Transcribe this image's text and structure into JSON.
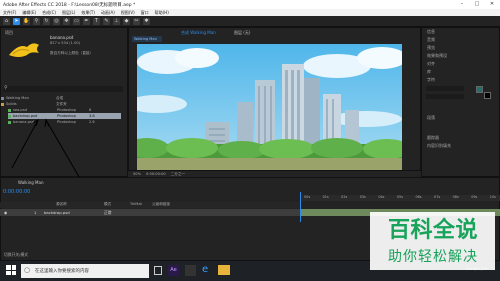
{
  "window": {
    "title": "Adobe After Effects CC 2018 - F:\\Lesson08\\无标题项目.aep *",
    "min": "–",
    "max": "□",
    "close": "✕"
  },
  "menu": [
    "文件(F)",
    "编辑(E)",
    "合成(C)",
    "图层(L)",
    "效果(T)",
    "动画(A)",
    "视图(V)",
    "窗口",
    "帮助(H)"
  ],
  "project": {
    "tab": "项目",
    "item_name": "banana.psd",
    "item_dims": "827 x 534 (1.00)",
    "item_type": "数百万种以上颜色（直接）",
    "rows": [
      {
        "name": "Walking Man",
        "type": "合成",
        "color": "#7b8a9c"
      },
      {
        "name": "Solids",
        "type": "文件夹",
        "color": "#c9a13a"
      },
      {
        "name": "sea.psd",
        "type": "Photoshop",
        "size": "6",
        "color": "#5ab35a"
      },
      {
        "name": "backdrop.psd",
        "type": "Photoshop",
        "size": "3.8",
        "color": "#5ab35a",
        "selected": true
      },
      {
        "name": "banana.psd",
        "type": "Photoshop",
        "size": "2.6",
        "color": "#5ab35a"
      }
    ]
  },
  "comp": {
    "tab": "合成 Walking Man",
    "tab2": "图层 (无)",
    "subtab": "Walking Man",
    "zoom": "50%",
    "timecode": "0:00:00:00",
    "res": "二分之一"
  },
  "right_panel": {
    "items": [
      "信息",
      "音频",
      "预览",
      "效果和预设",
      "对齐",
      "库",
      "字符",
      "段落",
      "跟踪器",
      "内容识别填充"
    ]
  },
  "timeline": {
    "tab": "Walking Man",
    "timecode": "0:00:00:00",
    "col_source": "源名称",
    "col_mode": "模式",
    "col_trk": "TrkMat",
    "col_parent": "父级和链接",
    "layer_num": "1",
    "layer_name": "backdrop.psd",
    "layer_mode": "正常",
    "ruler": [
      "00s",
      "01s",
      "02s",
      "03s",
      "04s",
      "05s",
      "06s",
      "07s",
      "08s",
      "09s",
      "10s"
    ],
    "toggle": "切换开关/模式"
  },
  "taskbar": {
    "search_placeholder": "在这里输入你要搜索的内容",
    "clock": "2018/11/15"
  },
  "watermark": {
    "title": "百科全说",
    "subtitle": "助你轻松解决"
  }
}
